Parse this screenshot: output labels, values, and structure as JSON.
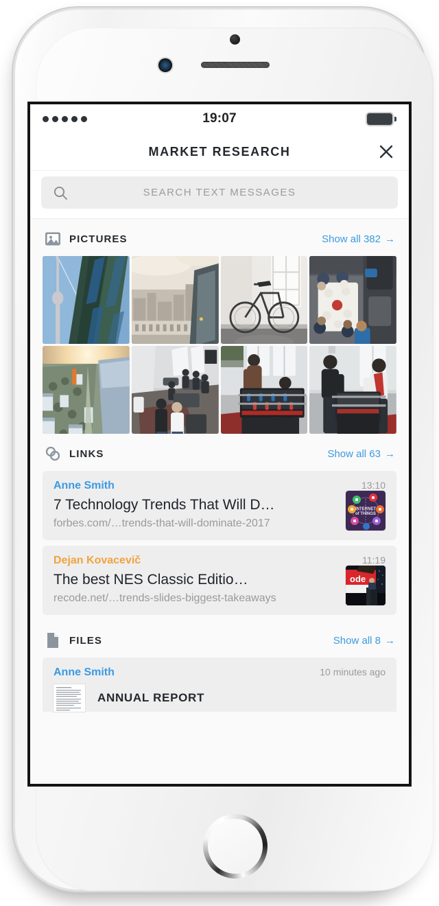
{
  "status_bar": {
    "time": "19:07",
    "signal_dots": 5,
    "battery_icon": "battery-full-icon"
  },
  "header": {
    "title": "MARKET RESEARCH",
    "close_icon": "close-icon"
  },
  "search": {
    "placeholder": "SEARCH TEXT MESSAGES",
    "value": "",
    "icon": "search-icon"
  },
  "colors": {
    "accent_blue": "#3b9ae1",
    "accent_orange": "#f0a33c",
    "screen_bg": "#fafafa",
    "card_bg": "#eeeeef",
    "text_dark": "#23282d",
    "text_muted": "#9a9a9a"
  },
  "sections": {
    "pictures": {
      "icon": "picture-icon",
      "title": "PICTURES",
      "show_all": "Show all 382",
      "show_all_arrow": "→",
      "count": 382,
      "photos": [
        {
          "name": "tv-tower-glass-facade",
          "alt": "TV tower behind green glass facade"
        },
        {
          "name": "city-rooftop-view",
          "alt": "Cityscape seen from a rooftop window"
        },
        {
          "name": "bicycle-in-room",
          "alt": "Bicycle leaning in a bright white room"
        },
        {
          "name": "overhead-dinner-table",
          "alt": "Overhead view of people around a table"
        },
        {
          "name": "aerial-sunset-city",
          "alt": "Aerial sunset view over a coastal city"
        },
        {
          "name": "office-interior-people",
          "alt": "Open-plan office with people"
        },
        {
          "name": "foosball-players-two",
          "alt": "Two men playing foosball"
        },
        {
          "name": "foosball-players-office",
          "alt": "Colleagues playing foosball in office"
        }
      ]
    },
    "links": {
      "icon": "link-icon",
      "title": "LINKS",
      "show_all": "Show all 63",
      "show_all_arrow": "→",
      "count": 63,
      "items": [
        {
          "sender": "Anne Smith",
          "sender_color": "blue",
          "time": "13:10",
          "title": "7 Technology Trends That Will D…",
          "url": "forbes.com/…trends-that-will-dominate-2017",
          "thumb": "internet-of-things-graphic"
        },
        {
          "sender": "Dejan Kovacevič",
          "sender_color": "orange",
          "time": "11:19",
          "title": "The best NES Classic Editio…",
          "url": "recode.net/…trends-slides-biggest-takeaways",
          "thumb": "recode-conference-stage"
        }
      ]
    },
    "files": {
      "icon": "file-icon",
      "title": "FILES",
      "show_all": "Show all 8",
      "show_all_arrow": "→",
      "count": 8,
      "items": [
        {
          "sender": "Anne Smith",
          "time": "10 minutes ago",
          "name": "ANNUAL REPORT",
          "thumb": "document-page-thumbnail"
        }
      ]
    }
  }
}
